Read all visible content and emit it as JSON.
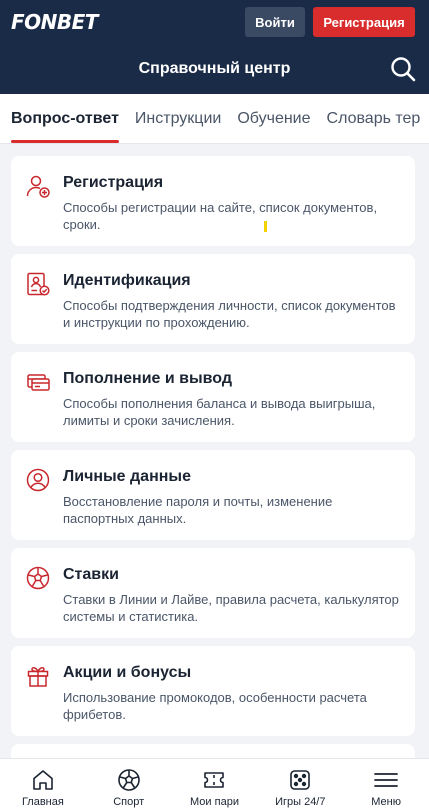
{
  "topbar": {
    "logo": "FONBET",
    "login_label": "Войти",
    "register_label": "Регистрация"
  },
  "header": {
    "title": "Справочный центр"
  },
  "tabs": [
    {
      "label": "Вопрос-ответ",
      "active": true
    },
    {
      "label": "Инструкции"
    },
    {
      "label": "Обучение"
    },
    {
      "label": "Словарь тер"
    }
  ],
  "categories": [
    {
      "title": "Регистрация",
      "desc": "Способы регистрации на сайте, список документов, сроки.",
      "icon": "user-add-icon"
    },
    {
      "title": "Идентификация",
      "desc": "Способы подтверждения личности, список документов и инструкции по прохождению.",
      "icon": "id-document-icon"
    },
    {
      "title": "Пополнение и вывод",
      "desc": "Способы пополнения баланса и вывода выигрыша, лимиты и сроки зачисления.",
      "icon": "wallet-card-icon"
    },
    {
      "title": "Личные данные",
      "desc": "Восстановление пароля и почты, изменение паспортных данных.",
      "icon": "user-circle-icon"
    },
    {
      "title": "Ставки",
      "desc": "Ставки в Линии и Лайве, правила расчета, калькулятор системы и статистика.",
      "icon": "soccer-ball-icon"
    },
    {
      "title": "Акции и бонусы",
      "desc": "Использование промокодов, особенности расчета фрибетов.",
      "icon": "gift-icon"
    }
  ],
  "bottom_nav": [
    {
      "label": "Главная",
      "icon": "home-icon"
    },
    {
      "label": "Спорт",
      "icon": "ball-icon"
    },
    {
      "label": "Мои пари",
      "icon": "ticket-icon"
    },
    {
      "label": "Игры 24/7",
      "icon": "dice-icon"
    },
    {
      "label": "Меню",
      "icon": "menu-icon"
    }
  ],
  "colors": {
    "brand_navy": "#1a2b47",
    "accent_red": "#d92d2d",
    "icon_red": "#c8282d"
  }
}
